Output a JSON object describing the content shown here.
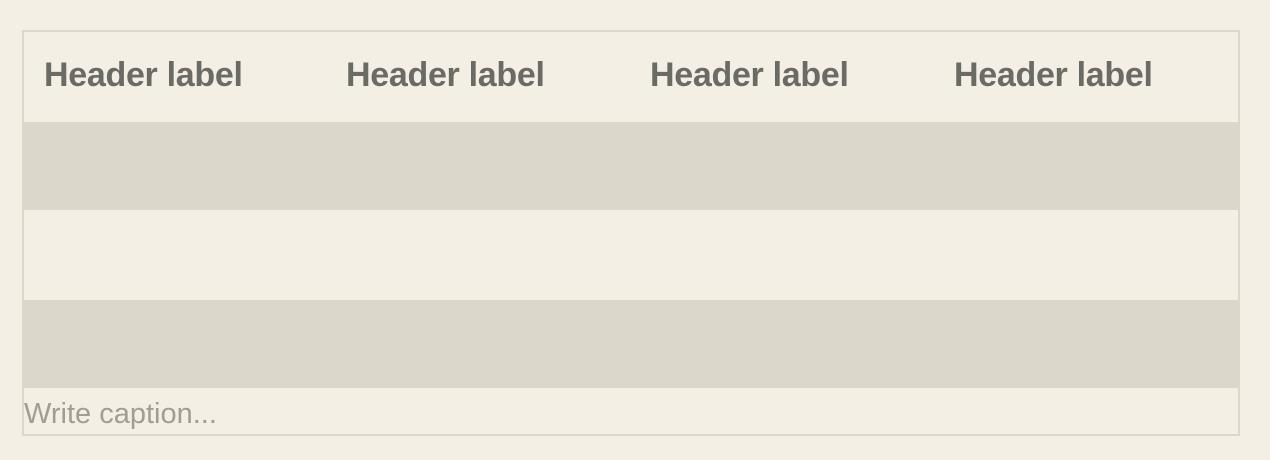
{
  "table": {
    "headers": [
      "Header label",
      "Header label",
      "Header label",
      "Header label"
    ],
    "rows": [
      {
        "shaded": true,
        "cells": [
          "",
          "",
          "",
          ""
        ]
      },
      {
        "shaded": false,
        "cells": [
          "",
          "",
          "",
          ""
        ]
      },
      {
        "shaded": true,
        "cells": [
          "",
          "",
          "",
          ""
        ]
      }
    ],
    "caption_placeholder": "Write caption..."
  },
  "colors": {
    "background": "#f4efe4",
    "border": "#dcd7cb",
    "shaded_row": "#dcd7cb",
    "header_text": "#6b6b66",
    "caption_text": "#a19d94"
  }
}
